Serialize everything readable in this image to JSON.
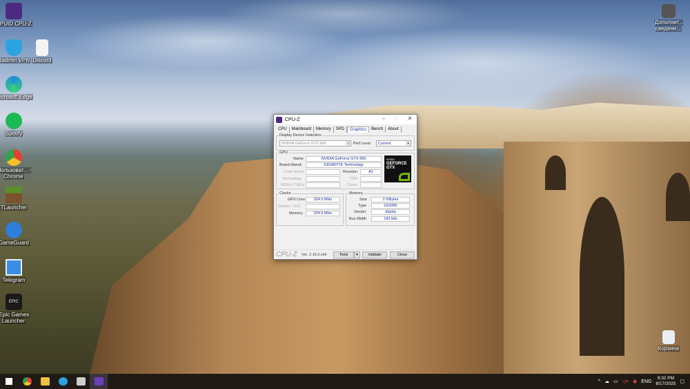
{
  "desktop": {
    "icons": [
      {
        "label": "CPUID CPU-Z",
        "color": "#4b2b7f"
      },
      {
        "label": "Radmin VPN",
        "color": "#2aa3e0"
      },
      {
        "label": "Discord",
        "color": "#f4f4f4"
      },
      {
        "label": "Microsoft Edge",
        "color": "#1f8fd8"
      },
      {
        "label": "Spotify",
        "color": "#1db954"
      },
      {
        "label": "Пользоват... - Chrome",
        "color": "#e34133"
      },
      {
        "label": "TLauncher",
        "color": "#5a8f2e"
      },
      {
        "label": "GameGuard",
        "color": "#2f7fd8"
      },
      {
        "label": "Telegram",
        "color": "#3a8ee6"
      },
      {
        "label": "Epic Games Launcher",
        "color": "#1a1a1a"
      }
    ],
    "right_icons": [
      {
        "label": "Дополнит... сведени..."
      },
      {
        "label": "Корзина"
      }
    ]
  },
  "cpuz": {
    "title": "CPU-Z",
    "tabs": [
      "CPU",
      "Mainboard",
      "Memory",
      "SPD",
      "Graphics",
      "Bench",
      "About"
    ],
    "active_tab": "Graphics",
    "display_group": "Display Device Selection",
    "device": "NVIDIA GeForce GTX 660",
    "perf_level_label": "Perf Level",
    "perf_level": "Current",
    "gpu_group": "GPU",
    "name_label": "Name",
    "name": "NVIDIA GeForce GTX 660",
    "board_label": "Board Manuf.",
    "board": "GIGABYTE Technology",
    "codename_label": "Code Name",
    "revision_label": "Revision",
    "revision": "A1",
    "technology_label": "Technology",
    "tdp_label": "TDP",
    "rops_label": "ROPs / TMUs",
    "cores_label": "Cores",
    "logo_text": [
      "NVIDIA",
      "GEFORCE",
      "GTX"
    ],
    "clocks_group": "Clocks",
    "gpu_core_label": "GPX Core",
    "gpu_core": "324.0 MHz",
    "shader_label": "Shader / SoC",
    "mem_clock_label": "Memory",
    "mem_clock": "324.0 MHz",
    "memory_group": "Memory",
    "size_label": "Size",
    "size": "2 GBytes",
    "type_label": "Type",
    "type": "GDDR5",
    "vendor_label": "Vendor",
    "vendor": "Elpida",
    "bus_label": "Bus Width",
    "bus": "192 bits",
    "brand": "CPU-Z",
    "version": "Ver. 2.16.0.x64",
    "tools": "Tools",
    "validate": "Validate",
    "close": "Close"
  },
  "tray": {
    "lang": "ENG",
    "time": "9:32 PM",
    "date": "8/17/2025"
  }
}
